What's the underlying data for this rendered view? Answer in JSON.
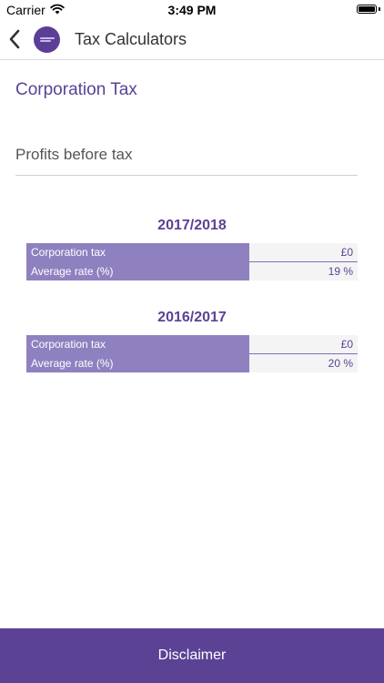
{
  "status_bar": {
    "carrier": "Carrier",
    "time": "3:49 PM",
    "icons": [
      "wifi-icon",
      "battery-icon"
    ]
  },
  "nav": {
    "title": "Tax Calculators",
    "icons": [
      "chevron-left-icon",
      "app-logo"
    ]
  },
  "page": {
    "title": "Corporation Tax",
    "input": {
      "placeholder": "Profits before tax",
      "value": ""
    }
  },
  "years": [
    {
      "year": "2017/2018",
      "rows": [
        {
          "label": "Corporation tax",
          "value": "£0"
        },
        {
          "label": "Average rate (%)",
          "value": "19 %"
        }
      ]
    },
    {
      "year": "2016/2017",
      "rows": [
        {
          "label": "Corporation tax",
          "value": "£0"
        },
        {
          "label": "Average rate (%)",
          "value": "20 %"
        }
      ]
    }
  ],
  "footer": {
    "label": "Disclaimer"
  },
  "colors": {
    "accent": "#5b4295",
    "label_cell": "#8f81c0",
    "value_cell": "#f4f4f4"
  }
}
